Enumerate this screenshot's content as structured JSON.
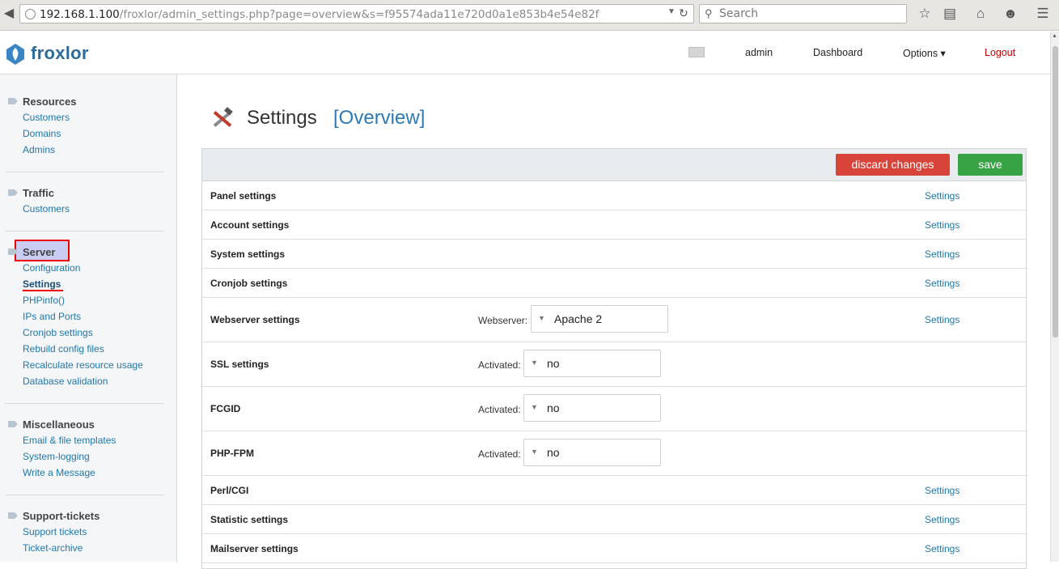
{
  "browser": {
    "url_host": "192.168.1.100",
    "url_path": "/froxlor/admin_settings.php?page=overview&s=f95574ada11e720d0a1e853b4e54e82f",
    "search_placeholder": "Search",
    "icons": [
      "back-arrow-icon",
      "globe-icon",
      "reload-icon",
      "search-icon",
      "bookmark-star-icon",
      "reading-list-icon",
      "home-icon",
      "chat-icon",
      "menu-icon"
    ]
  },
  "header": {
    "logo": "froxlor",
    "user": "admin",
    "dashboard": "Dashboard",
    "options": "Options ▾",
    "logout": "Logout"
  },
  "sidebar": {
    "sections": [
      {
        "title": "Resources",
        "items": [
          "Customers",
          "Domains",
          "Admins"
        ]
      },
      {
        "title": "Traffic",
        "items": [
          "Customers"
        ]
      },
      {
        "title": "Server",
        "items": [
          "Configuration",
          "Settings",
          "PHPinfo()",
          "IPs and Ports",
          "Cronjob settings",
          "Rebuild config files",
          "Recalculate resource usage",
          "Database validation"
        ]
      },
      {
        "title": "Miscellaneous",
        "items": [
          "Email & file templates",
          "System-logging",
          "Write a Message"
        ]
      },
      {
        "title": "Support-tickets",
        "items": [
          "Support tickets",
          "Ticket-archive"
        ]
      }
    ],
    "active_section": "Server",
    "active_item": "Settings"
  },
  "main": {
    "title": "Settings",
    "subtitle_open": "[",
    "subtitle": "Overview",
    "subtitle_close": "]",
    "buttons": {
      "discard": "discard changes",
      "save": "save"
    },
    "rows": [
      {
        "label": "Panel settings",
        "link": "Settings"
      },
      {
        "label": "Account settings",
        "link": "Settings"
      },
      {
        "label": "System settings",
        "link": "Settings"
      },
      {
        "label": "Cronjob settings",
        "link": "Settings"
      },
      {
        "label": "Webserver settings",
        "field_label": "Webserver:",
        "field_value": "Apache 2",
        "link": "Settings"
      },
      {
        "label": "SSL settings",
        "field_label": "Activated:",
        "field_value": "no"
      },
      {
        "label": "FCGID",
        "field_label": "Activated:",
        "field_value": "no"
      },
      {
        "label": "PHP-FPM",
        "field_label": "Activated:",
        "field_value": "no"
      },
      {
        "label": "Perl/CGI",
        "link": "Settings"
      },
      {
        "label": "Statistic settings",
        "link": "Settings"
      },
      {
        "label": "Mailserver settings",
        "link": "Settings"
      }
    ]
  },
  "colors": {
    "accent": "#2b7ab7",
    "link": "#2277aa",
    "discard": "#d9443a",
    "save": "#37a345",
    "logout": "#cc0000",
    "highlight": "#c9cdf2"
  }
}
